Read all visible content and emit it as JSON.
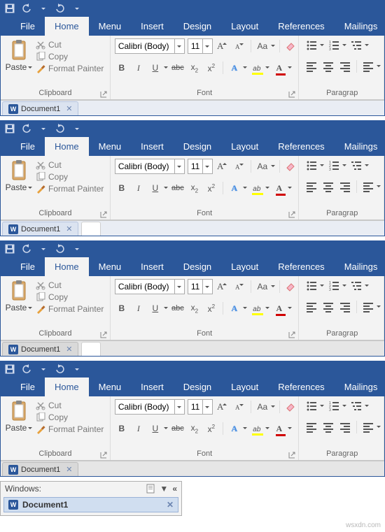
{
  "qat": {
    "undo_tip": "Undo",
    "redo_tip": "Redo"
  },
  "tabs": {
    "file": "File",
    "home": "Home",
    "menu": "Menu",
    "insert": "Insert",
    "design": "Design",
    "layout": "Layout",
    "references": "References",
    "mailings": "Mailings"
  },
  "clipboard": {
    "paste": "Paste",
    "cut": "Cut",
    "copy": "Copy",
    "format_painter": "Format Painter",
    "group_label": "Clipboard"
  },
  "font": {
    "name": "Calibri (Body)",
    "size": "11",
    "group_label": "Font",
    "case_label": "Aa",
    "bold": "B",
    "italic": "I",
    "underline": "U",
    "strike": "abc",
    "sub": "x",
    "sup": "x",
    "texteffects": "A"
  },
  "paragraph": {
    "group_label": "Paragrap"
  },
  "doc": {
    "name": "Document1"
  },
  "panel": {
    "title": "Windows:",
    "item": "Document1"
  },
  "watermark": "wsxdn.com"
}
